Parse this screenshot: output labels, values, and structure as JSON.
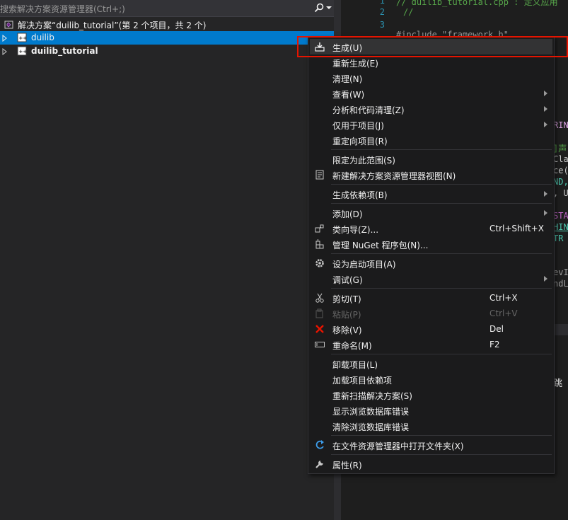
{
  "solution_explorer": {
    "search_placeholder": "搜索解决方案资源管理器(Ctrl+;)",
    "solution_label": "解决方案“duilib_tutorial”(第 2 个项目，共 2 个)",
    "projects": [
      {
        "name": "duilib",
        "selected": true
      },
      {
        "name": "duilib_tutorial",
        "selected": false,
        "bold": true
      }
    ]
  },
  "editor": {
    "line_numbers": [
      "1",
      "2",
      "3"
    ],
    "lines": [
      "// duilib_tutorial.cpp : 定义应用",
      "//",
      "",
      "#include \"framework.h\""
    ],
    "fragments": [
      "RING",
      "]声",
      "Cla",
      "ce(",
      "ND,",
      ", U",
      "STA",
      "HIN",
      "TR",
      "evI",
      "ndL"
    ],
    "behind_menu_text": "跳"
  },
  "context_menu": {
    "groups": [
      [
        {
          "label": "生成(U)",
          "icon": "build-icon",
          "highlighted": true
        },
        {
          "label": "重新生成(E)"
        },
        {
          "label": "清理(N)"
        },
        {
          "label": "查看(W)",
          "submenu": true
        },
        {
          "label": "分析和代码清理(Z)",
          "submenu": true
        },
        {
          "label": "仅用于项目(J)",
          "submenu": true
        },
        {
          "label": "重定向项目(R)"
        }
      ],
      [
        {
          "label": "限定为此范围(S)"
        },
        {
          "label": "新建解决方案资源管理器视图(N)",
          "icon": "new-view-icon"
        }
      ],
      [
        {
          "label": "生成依赖项(B)",
          "submenu": true
        }
      ],
      [
        {
          "label": "添加(D)",
          "submenu": true
        },
        {
          "label": "类向导(Z)...",
          "icon": "class-wizard-icon",
          "shortcut": "Ctrl+Shift+X"
        },
        {
          "label": "管理 NuGet 程序包(N)...",
          "icon": "nuget-icon"
        }
      ],
      [
        {
          "label": "设为启动项目(A)",
          "icon": "gear-icon"
        },
        {
          "label": "调试(G)",
          "submenu": true
        }
      ],
      [
        {
          "label": "剪切(T)",
          "icon": "scissors-icon",
          "shortcut": "Ctrl+X"
        },
        {
          "label": "粘贴(P)",
          "icon": "paste-icon",
          "shortcut": "Ctrl+V",
          "disabled": true
        },
        {
          "label": "移除(V)",
          "icon": "remove-icon",
          "shortcut": "Del"
        },
        {
          "label": "重命名(M)",
          "icon": "rename-icon",
          "shortcut": "F2"
        }
      ],
      [
        {
          "label": "卸载项目(L)"
        },
        {
          "label": "加载项目依赖项"
        },
        {
          "label": "重新扫描解决方案(S)"
        },
        {
          "label": "显示浏览数据库错误"
        },
        {
          "label": "清除浏览数据库错误"
        }
      ],
      [
        {
          "label": "在文件资源管理器中打开文件夹(X)",
          "icon": "open-folder-icon"
        }
      ],
      [
        {
          "label": "属性(R)",
          "icon": "wrench-icon"
        }
      ]
    ]
  },
  "colors": {
    "selection": "#007acc",
    "highlight_box": "#e51400",
    "remove_icon": "#e51400"
  }
}
